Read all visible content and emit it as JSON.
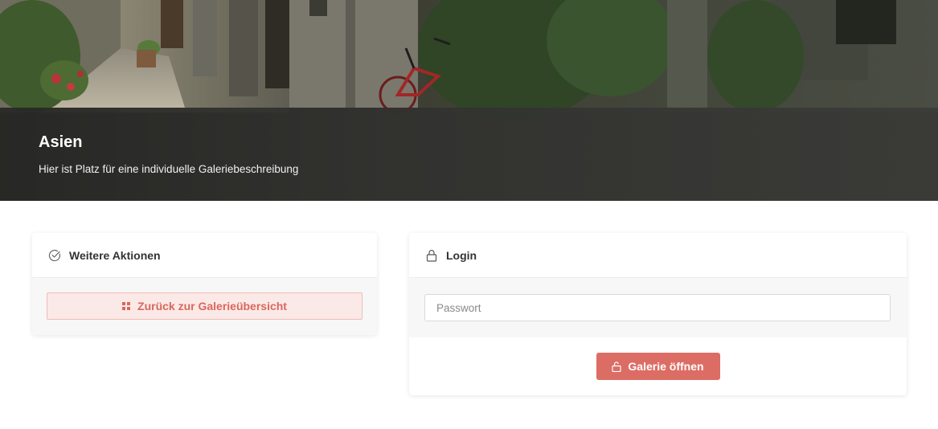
{
  "hero": {
    "title": "Asien",
    "description": "Hier ist Platz für eine individuelle Galeriebeschreibung"
  },
  "actions_card": {
    "title": "Weitere Aktionen",
    "icon": "check-circle-icon",
    "back_button_label": "Zurück zur Galerieübersicht",
    "back_button_icon": "grid-icon"
  },
  "login_card": {
    "title": "Login",
    "icon": "lock-icon",
    "password_placeholder": "Passwort",
    "password_value": "",
    "submit_label": "Galerie öffnen",
    "submit_icon": "unlock-icon"
  },
  "colors": {
    "accent": "#dc6d64",
    "accent_light": "#fbe9e7",
    "hero_overlay": "#2f2f2d"
  }
}
